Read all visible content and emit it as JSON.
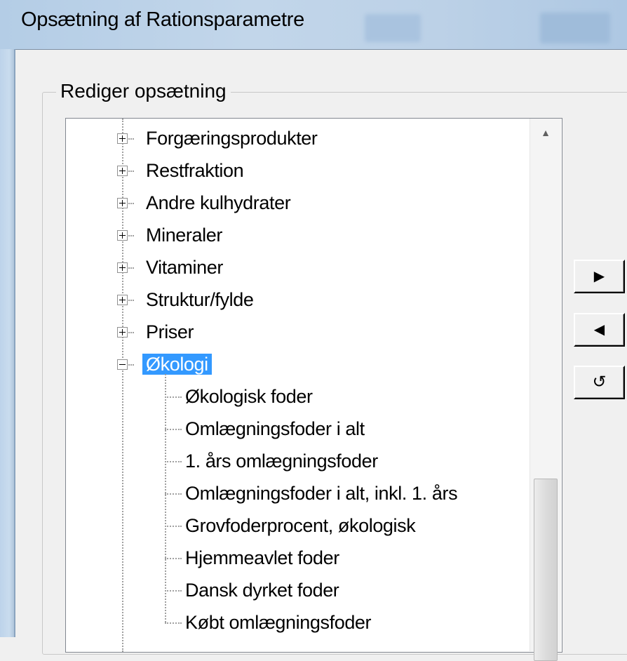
{
  "window": {
    "title": "Opsætning af Rationsparametre"
  },
  "group": {
    "legend": "Rediger opsætning"
  },
  "tree": {
    "collapsed_items": [
      "Forgæringsprodukter",
      "Restfraktion",
      "Andre kulhydrater",
      "Mineraler",
      "Vitaminer",
      "Struktur/fylde",
      "Priser"
    ],
    "expanded_item": "Økologi",
    "children": [
      "Økologisk foder",
      "Omlægningsfoder i alt",
      "1. års omlægningsfoder",
      "Omlægningsfoder i alt, inkl. 1. års",
      "Grovfoderprocent, økologisk",
      "Hjemmeavlet foder",
      "Dansk dyrket foder",
      "Købt omlægningsfoder"
    ],
    "selected_item": "Økologi",
    "selection_color": "#3399ff"
  },
  "buttons": {
    "add_icon": "play-right-icon",
    "add_glyph": "▶",
    "remove_icon": "play-left-icon",
    "remove_glyph": "◀",
    "reset_icon": "undo-icon",
    "reset_glyph": "↺"
  },
  "scrollbar": {
    "up_glyph": "▲"
  }
}
